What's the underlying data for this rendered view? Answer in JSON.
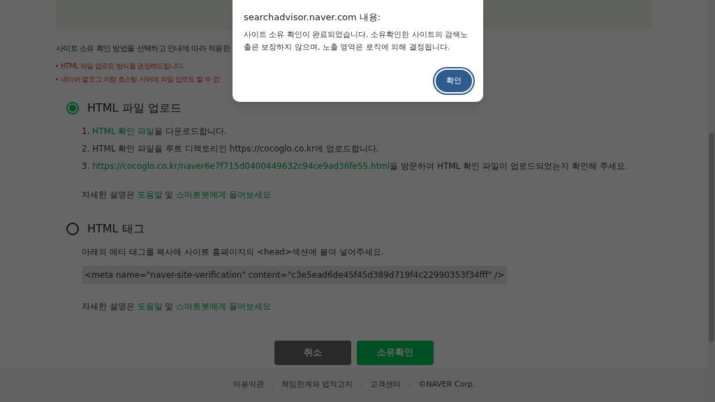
{
  "intro": "사이트 소유 확인 방법을 선택하고 안내에 따라 적용한",
  "notes": [
    "HTML 파일 업로드 방식을 권장해드립니다.",
    "네이버 블로그 처럼 호스팅 서버에 파일 업로드 할 수 없"
  ],
  "methods": [
    {
      "title": "HTML 파일 업로드",
      "selected": true,
      "kind": "steps",
      "steps": [
        [
          {
            "text": "1. ",
            "kind": "plain"
          },
          {
            "text": "HTML 확인 파일",
            "kind": "link"
          },
          {
            "text": "을 다운로드합니다.",
            "kind": "plain"
          }
        ],
        [
          {
            "text": "2. HTML 확인 파일을 루트 디렉토리인 https://cocoglo.co.kr에 업로드합니다.",
            "kind": "plain"
          }
        ],
        [
          {
            "text": "3. ",
            "kind": "plain"
          },
          {
            "text": "https://cocoglo.co.kr/naver6e7f715d0400449632c94ce9ad36fe55.html",
            "kind": "link"
          },
          {
            "text": "을 방문하여 HTML 확인 파일이 업로드되었는지 확인해 주세요.",
            "kind": "plain"
          }
        ]
      ],
      "help": [
        {
          "text": "자세한 설명은 ",
          "kind": "plain"
        },
        {
          "text": "도움말",
          "kind": "link"
        },
        {
          "text": " 및 ",
          "kind": "plain"
        },
        {
          "text": "스마트봇에게 물어보세요",
          "kind": "link"
        }
      ]
    },
    {
      "title": "HTML 태그",
      "selected": false,
      "kind": "tag",
      "description": "아래의 메타 태그를 복사해 사이트 홈페이지의 <head>섹션에 붙여 넣어주세요.",
      "code": "<meta name=\"naver-site-verification\" content=\"c3e5ead6de45f45d389d719f4c22990353f34fff\" />",
      "help": [
        {
          "text": "자세한 설명은 ",
          "kind": "plain"
        },
        {
          "text": "도움말",
          "kind": "link"
        },
        {
          "text": " 및 ",
          "kind": "plain"
        },
        {
          "text": "스마트봇에게 물어보세요",
          "kind": "link"
        }
      ]
    }
  ],
  "buttons": [
    {
      "label": "취소",
      "kind": "secondary"
    },
    {
      "label": "소유확인",
      "kind": "primary"
    }
  ],
  "footer": [
    "이용약관",
    "책임한계와 법적고지",
    "고객센터",
    "©NAVER Corp."
  ],
  "dialog": {
    "title": "searchadvisor.naver.com 내용:",
    "message": "사이트 소유 확인이 완료되었습니다. 소유확인한 사이트의 검색노출은 보장하지 않으며, 노출 영역은 로직에 의해 결정됩니다.",
    "button": "확인"
  }
}
